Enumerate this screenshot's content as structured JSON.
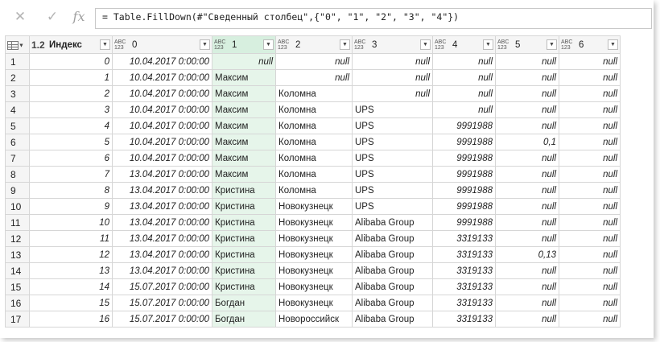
{
  "formula": {
    "cancel_symbol": "✕",
    "confirm_symbol": "✓",
    "fx_label": "fx",
    "expression": "= Table.FillDown(#\"Сведенный столбец\",{\"0\", \"1\", \"2\", \"3\", \"4\"})"
  },
  "table": {
    "index_type": "1.2",
    "type_abc": "ABC",
    "type_123": "123",
    "columns": [
      "Индекс",
      "0",
      "1",
      "2",
      "3",
      "4",
      "5",
      "6"
    ],
    "rows": [
      {
        "n": "1",
        "idx": "0",
        "c0": "10.04.2017 0:00:00",
        "c1": "null",
        "c2": "null",
        "c3": "null",
        "c4": "null",
        "c5": "null",
        "c6": "null"
      },
      {
        "n": "2",
        "idx": "1",
        "c0": "10.04.2017 0:00:00",
        "c1": "Максим",
        "c2": "null",
        "c3": "null",
        "c4": "null",
        "c5": "null",
        "c6": "null"
      },
      {
        "n": "3",
        "idx": "2",
        "c0": "10.04.2017 0:00:00",
        "c1": "Максим",
        "c2": "Коломна",
        "c3": "null",
        "c4": "null",
        "c5": "null",
        "c6": "null"
      },
      {
        "n": "4",
        "idx": "3",
        "c0": "10.04.2017 0:00:00",
        "c1": "Максим",
        "c2": "Коломна",
        "c3": "UPS",
        "c4": "null",
        "c5": "null",
        "c6": "null"
      },
      {
        "n": "5",
        "idx": "4",
        "c0": "10.04.2017 0:00:00",
        "c1": "Максим",
        "c2": "Коломна",
        "c3": "UPS",
        "c4": "9991988",
        "c5": "null",
        "c6": "null"
      },
      {
        "n": "6",
        "idx": "5",
        "c0": "10.04.2017 0:00:00",
        "c1": "Максим",
        "c2": "Коломна",
        "c3": "UPS",
        "c4": "9991988",
        "c5": "0,1",
        "c6": "null"
      },
      {
        "n": "7",
        "idx": "6",
        "c0": "10.04.2017 0:00:00",
        "c1": "Максим",
        "c2": "Коломна",
        "c3": "UPS",
        "c4": "9991988",
        "c5": "null",
        "c6": "null"
      },
      {
        "n": "8",
        "idx": "7",
        "c0": "13.04.2017 0:00:00",
        "c1": "Максим",
        "c2": "Коломна",
        "c3": "UPS",
        "c4": "9991988",
        "c5": "null",
        "c6": "null"
      },
      {
        "n": "9",
        "idx": "8",
        "c0": "13.04.2017 0:00:00",
        "c1": "Кристина",
        "c2": "Коломна",
        "c3": "UPS",
        "c4": "9991988",
        "c5": "null",
        "c6": "null"
      },
      {
        "n": "10",
        "idx": "9",
        "c0": "13.04.2017 0:00:00",
        "c1": "Кристина",
        "c2": "Новокузнецк",
        "c3": "UPS",
        "c4": "9991988",
        "c5": "null",
        "c6": "null"
      },
      {
        "n": "11",
        "idx": "10",
        "c0": "13.04.2017 0:00:00",
        "c1": "Кристина",
        "c2": "Новокузнецк",
        "c3": "Alibaba Group",
        "c4": "9991988",
        "c5": "null",
        "c6": "null"
      },
      {
        "n": "12",
        "idx": "11",
        "c0": "13.04.2017 0:00:00",
        "c1": "Кристина",
        "c2": "Новокузнецк",
        "c3": "Alibaba Group",
        "c4": "3319133",
        "c5": "null",
        "c6": "null"
      },
      {
        "n": "13",
        "idx": "12",
        "c0": "13.04.2017 0:00:00",
        "c1": "Кристина",
        "c2": "Новокузнецк",
        "c3": "Alibaba Group",
        "c4": "3319133",
        "c5": "0,13",
        "c6": "null"
      },
      {
        "n": "14",
        "idx": "13",
        "c0": "13.04.2017 0:00:00",
        "c1": "Кристина",
        "c2": "Новокузнецк",
        "c3": "Alibaba Group",
        "c4": "3319133",
        "c5": "null",
        "c6": "null"
      },
      {
        "n": "15",
        "idx": "14",
        "c0": "15.07.2017 0:00:00",
        "c1": "Кристина",
        "c2": "Новокузнецк",
        "c3": "Alibaba Group",
        "c4": "3319133",
        "c5": "null",
        "c6": "null"
      },
      {
        "n": "16",
        "idx": "15",
        "c0": "15.07.2017 0:00:00",
        "c1": "Богдан",
        "c2": "Новокузнецк",
        "c3": "Alibaba Group",
        "c4": "3319133",
        "c5": "null",
        "c6": "null"
      },
      {
        "n": "17",
        "idx": "16",
        "c0": "15.07.2017 0:00:00",
        "c1": "Богдан",
        "c2": "Новороссийск",
        "c3": "Alibaba Group",
        "c4": "3319133",
        "c5": "null",
        "c6": "null"
      }
    ]
  }
}
